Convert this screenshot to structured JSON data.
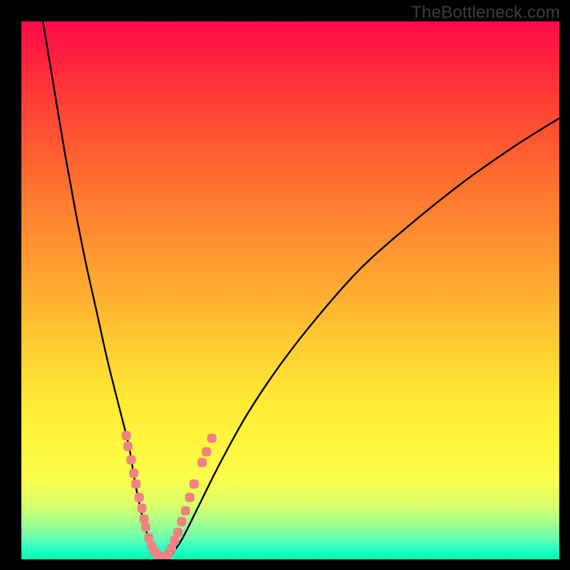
{
  "watermark": "TheBottleneck.com",
  "chart_data": {
    "type": "line",
    "title": "",
    "xlabel": "",
    "ylabel": "",
    "xlim": [
      0,
      100
    ],
    "ylim": [
      0,
      100
    ],
    "series": [
      {
        "name": "bottleneck-curve",
        "x": [
          4,
          6,
          8,
          10,
          12,
          14,
          16,
          18,
          20,
          21,
          22,
          23,
          24,
          25,
          26,
          27,
          28,
          30,
          33,
          37,
          42,
          48,
          55,
          63,
          72,
          82,
          92,
          100
        ],
        "y": [
          100,
          88,
          76,
          65,
          55,
          46,
          37,
          29,
          21,
          15,
          10,
          6,
          3,
          1,
          0,
          0,
          1,
          4,
          10,
          18,
          27,
          36,
          45,
          54,
          62,
          70,
          77,
          82
        ]
      }
    ],
    "markers": [
      {
        "name": "marker-cluster",
        "color": "#f28282",
        "points": [
          {
            "x": 19.5,
            "y": 23
          },
          {
            "x": 19.8,
            "y": 21
          },
          {
            "x": 20.4,
            "y": 18.5
          },
          {
            "x": 20.9,
            "y": 16
          },
          {
            "x": 21.3,
            "y": 14
          },
          {
            "x": 21.9,
            "y": 11.5
          },
          {
            "x": 22.4,
            "y": 9.5
          },
          {
            "x": 22.8,
            "y": 7.5
          },
          {
            "x": 23.1,
            "y": 6
          },
          {
            "x": 23.7,
            "y": 4
          },
          {
            "x": 24.2,
            "y": 2.5
          },
          {
            "x": 24.8,
            "y": 1.5
          },
          {
            "x": 25.3,
            "y": 0.8
          },
          {
            "x": 26.0,
            "y": 0.4
          },
          {
            "x": 26.7,
            "y": 0.4
          },
          {
            "x": 27.3,
            "y": 1.0
          },
          {
            "x": 27.9,
            "y": 2.0
          },
          {
            "x": 28.5,
            "y": 3.5
          },
          {
            "x": 29.1,
            "y": 5.0
          },
          {
            "x": 29.8,
            "y": 7.0
          },
          {
            "x": 30.5,
            "y": 9.0
          },
          {
            "x": 31.3,
            "y": 11.5
          },
          {
            "x": 32.1,
            "y": 14.0
          },
          {
            "x": 33.6,
            "y": 18.0
          },
          {
            "x": 34.4,
            "y": 20.0
          },
          {
            "x": 35.4,
            "y": 22.5
          }
        ]
      }
    ],
    "background_gradient": {
      "top": "#ff0a4a",
      "upper_mid": "#ff8f30",
      "mid": "#ffe935",
      "lower_mid": "#a6ff8c",
      "bottom": "#00ffb0"
    }
  }
}
